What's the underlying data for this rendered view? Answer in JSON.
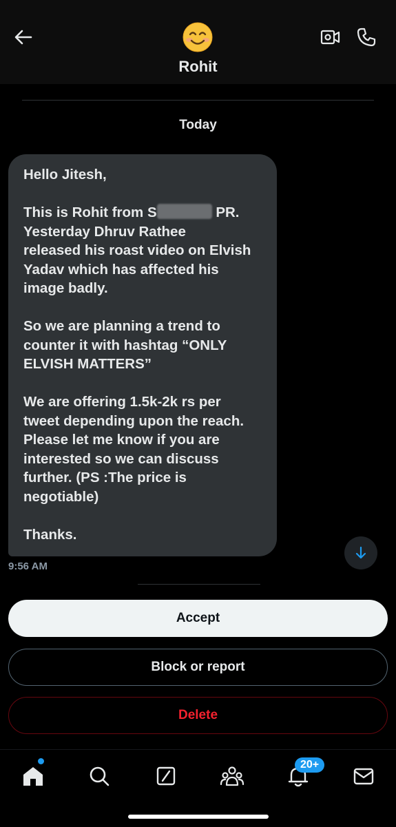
{
  "header": {
    "title": "Rohit",
    "avatar_icon": "smiling-face-emoji",
    "back_icon": "arrow-left-icon",
    "video_icon": "video-camera-icon",
    "call_icon": "phone-icon"
  },
  "conversation": {
    "date_label": "Today",
    "message": {
      "greeting": "Hello Jitesh,",
      "p1_before": "This is Rohit from S",
      "p1_after": " PR.\nYesterday Dhruv Rathee\nreleased his roast video on Elvish\nYadav which has affected his\nimage badly.",
      "p2": "So we are planning a trend to\ncounter it with hashtag “ONLY\nELVISH MATTERS”",
      "p3": "We are offering 1.5k-2k rs per\ntweet depending upon the reach.\nPlease let me know if you are\ninterested so we can discuss\nfurther. (PS :The price is\nnegotiable)",
      "signoff": "Thanks.",
      "time": "9:56 AM"
    }
  },
  "actions": {
    "accept": "Accept",
    "block_report": "Block or report",
    "delete": "Delete"
  },
  "tabbar": {
    "items": [
      "home-icon",
      "search-icon",
      "grok-icon",
      "communities-icon",
      "notifications-icon",
      "messages-icon"
    ],
    "notification_badge": "20+"
  },
  "colors": {
    "accent": "#1d9bf0",
    "bubble": "#2f3336",
    "danger": "#f4212e",
    "background": "#000000"
  }
}
